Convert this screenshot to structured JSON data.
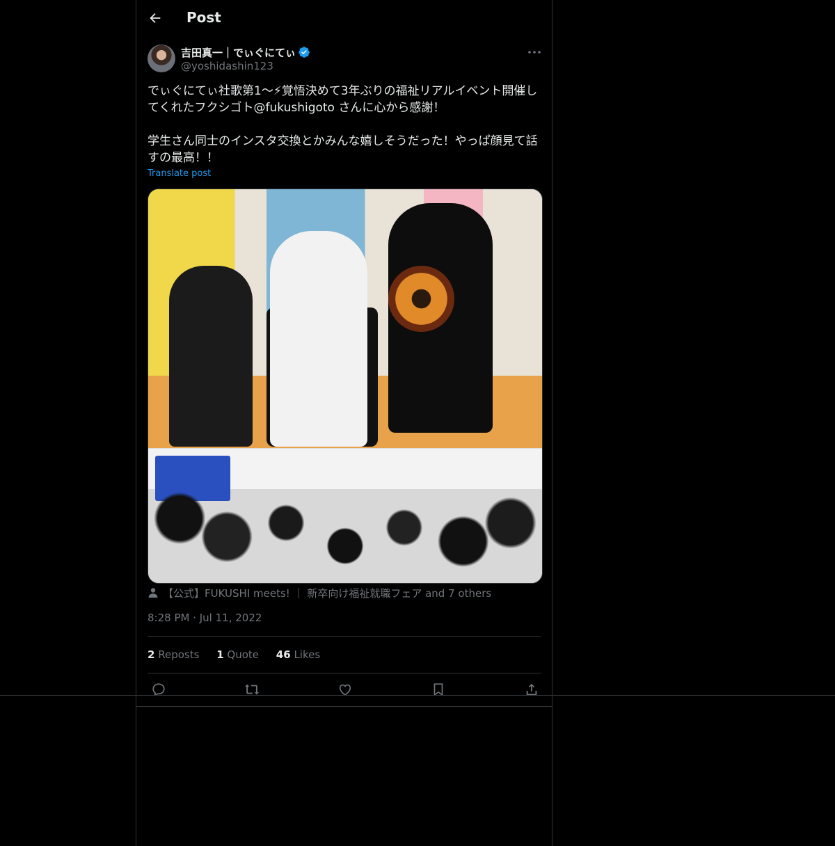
{
  "header": {
    "title": "Post"
  },
  "post": {
    "author_name": "吉田真一｜でぃぐにてぃ",
    "handle": "@yoshidashin123",
    "text": "でぃぐにてぃ社歌第1〜⚡覚悟決めて3年ぶりの福祉リアルイベント開催してくれたフクシゴト@fukushigoto さんに心から感謝！\n\n学生さん同士のインスタ交換とかみんな嬉しそうだった！やっぱ顔見て話すの最高！！",
    "translate_label": "Translate post",
    "tagged": "【公式】FUKUSHI meets! ｜ 新卒向け福祉就職フェア and 7 others",
    "time": "8:28 PM · Jul 11, 2022"
  },
  "stats": {
    "reposts_count": "2",
    "reposts_label": "Reposts",
    "quotes_count": "1",
    "quotes_label": "Quote",
    "likes_count": "46",
    "likes_label": "Likes"
  },
  "colors": {
    "accent": "#1d9bf0",
    "muted": "#71767b",
    "border": "#2f3336",
    "text": "#e7e9ea",
    "background": "#000000"
  },
  "icons": [
    "back-arrow-icon",
    "verified-badge-icon",
    "more-icon",
    "person-icon",
    "reply-icon",
    "repost-icon",
    "like-icon",
    "bookmark-icon",
    "share-icon"
  ]
}
